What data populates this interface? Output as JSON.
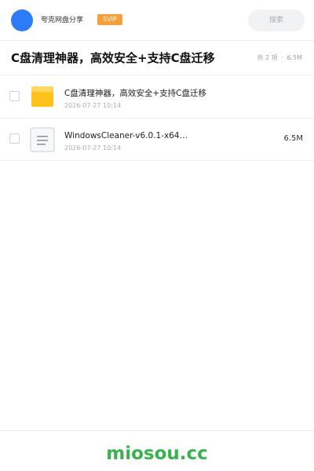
{
  "header": {
    "user_name": "夸克网盘分享",
    "badge": "SVIP",
    "search_label": "搜索",
    "avatar_color": "#2b7cf6",
    "badge_color": "#f6a03a"
  },
  "share": {
    "title": "C盘清理神器，高效安全+支持C盘迁移",
    "count_label": "共 2 项",
    "separator": "·",
    "total_size": "6.5M"
  },
  "files": [
    {
      "name": "C盘清理神器，高效安全+支持C盘迁移",
      "date": "2026-07-27 10:14",
      "size": "",
      "icon": "folder-icon"
    },
    {
      "name": "WindowsCleaner-v6.0.1-x64…",
      "date": "2026-07-27 10:14",
      "size": "6.5M",
      "icon": "document-icon"
    }
  ],
  "footer": {
    "watermark": "miosou.cc",
    "watermark_color": "#37b24d"
  }
}
